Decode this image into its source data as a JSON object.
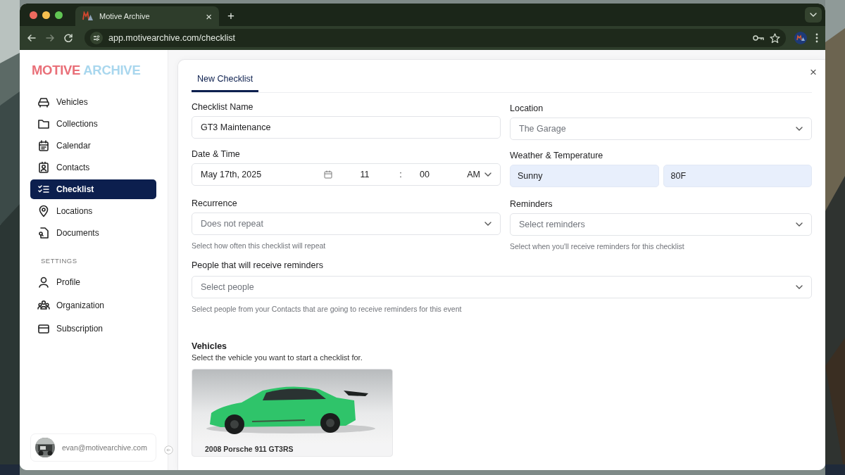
{
  "browser": {
    "tab_title": "Motive Archive",
    "tab_close": "×",
    "new_tab": "+",
    "url": "app.motivearchive.com/checklist"
  },
  "sidebar": {
    "logo": [
      "MOTIVE",
      "ARCHIVE"
    ],
    "items": [
      {
        "label": "Vehicles",
        "selected": false
      },
      {
        "label": "Collections",
        "selected": false
      },
      {
        "label": "Calendar",
        "selected": false
      },
      {
        "label": "Contacts",
        "selected": false
      },
      {
        "label": "Checklist",
        "selected": true
      },
      {
        "label": "Locations",
        "selected": false
      },
      {
        "label": "Documents",
        "selected": false
      }
    ],
    "settings_heading": "SETTINGS",
    "settings_items": [
      {
        "label": "Profile",
        "selected": false
      },
      {
        "label": "Organization",
        "selected": false
      },
      {
        "label": "Subscription",
        "selected": false
      }
    ],
    "user_email": "evan@motivearchive.com"
  },
  "dialog": {
    "tabs": [
      {
        "label": "New Checklist",
        "selected": true
      }
    ],
    "close": "×",
    "checklist_name": {
      "label": "Checklist Name",
      "value": "GT3 Maintenance"
    },
    "location": {
      "label": "Location",
      "value": "The Garage"
    },
    "date_time": {
      "label": "Date & Time",
      "date": "May 17th, 2025",
      "hour": "11",
      "separator": ":",
      "minute": "00",
      "period": "AM"
    },
    "weather": {
      "label": "Weather & Temperature",
      "weather": "Sunny",
      "temperature": "80F"
    },
    "recurrence": {
      "label": "Recurrence",
      "placeholder": "Does not repeat",
      "hint": "Select how often this checklist will repeat"
    },
    "reminders": {
      "label": "Reminders",
      "placeholder": "Select reminders",
      "hint": "Select when you'll receive reminders for this checklist"
    },
    "people": {
      "label": "People that will receive reminders",
      "placeholder": "Select people",
      "hint": "Select people from your Contacts that are going to receive reminders for this event"
    },
    "vehicles": {
      "title": "Vehicles",
      "subtitle": "Select the vehicle you want to start a checklist for.",
      "cards": [
        {
          "caption": "2008 Porsche 911 GT3RS",
          "kind": "picture"
        }
      ]
    }
  }
}
